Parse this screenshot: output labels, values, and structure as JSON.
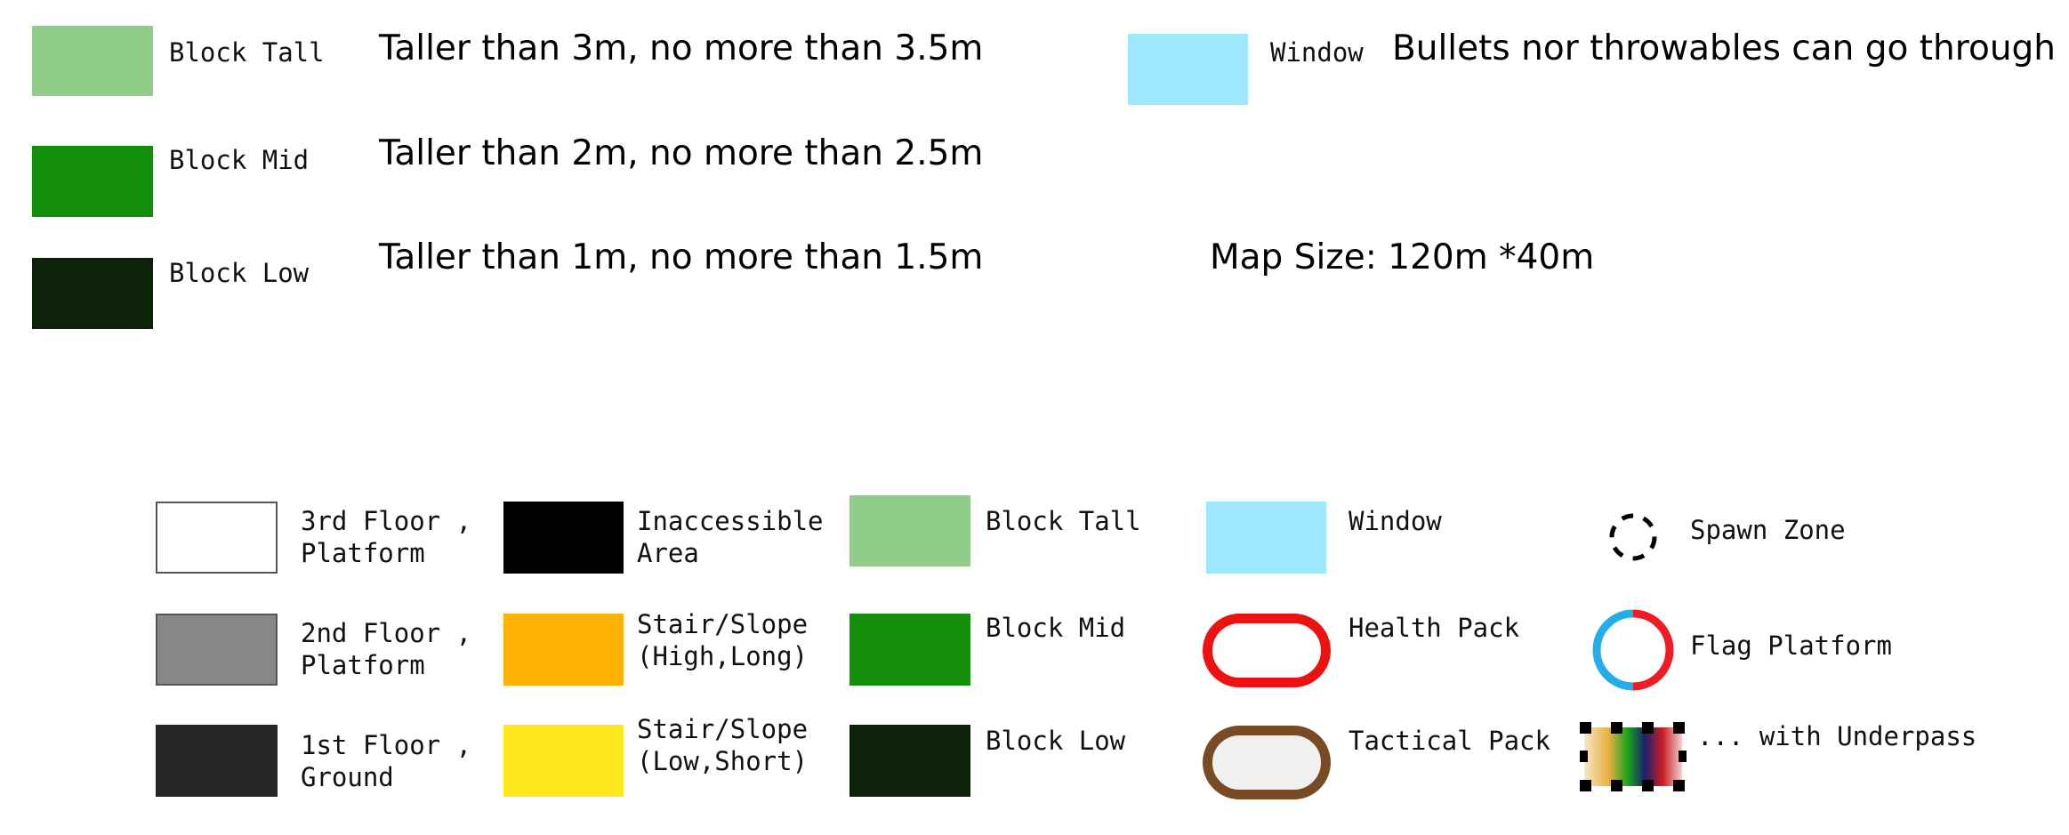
{
  "top_legend": {
    "block_tall": {
      "label": "Block Tall",
      "desc": "Taller than 3m, no more than 3.5m",
      "color": "#8fcd88"
    },
    "block_mid": {
      "label": "Block Mid",
      "desc": "Taller than 2m, no more than 2.5m",
      "color": "#148f0b"
    },
    "block_low": {
      "label": "Block Low",
      "desc": "Taller than 1m, no more than 1.5m",
      "color": "#0c2309"
    },
    "window": {
      "label": "Window",
      "desc": "Bullets nor throwables can go through",
      "color": "#9de8fd"
    },
    "map_size": "Map Size: 120m *40m"
  },
  "bottom_legend": {
    "floor3": {
      "label": "3rd Floor ,\nPlatform",
      "color": "#ffffff"
    },
    "floor2": {
      "label": "2nd Floor ,\nPlatform",
      "color": "#878787"
    },
    "floor1": {
      "label": "1st Floor ,\nGround",
      "color": "#262626"
    },
    "inaccessible": {
      "label": "Inaccessible\nArea",
      "color": "#000000"
    },
    "stair_high": {
      "label": "Stair/Slope\n(High,Long)",
      "color": "#feb304"
    },
    "stair_low": {
      "label": "Stair/Slope\n(Low,Short)",
      "color": "#ffe81c"
    },
    "block_tall": {
      "label": "Block Tall",
      "color": "#8fcd88"
    },
    "block_mid": {
      "label": "Block Mid",
      "color": "#148f0b"
    },
    "block_low": {
      "label": "Block Low",
      "color": "#0c2309"
    },
    "window": {
      "label": "Window",
      "color": "#9de8fd"
    },
    "health_pack": {
      "label": "Health Pack",
      "color": "#ee1111"
    },
    "tactical_pack": {
      "label": "Tactical Pack",
      "color": "#774c25"
    },
    "spawn_zone": {
      "label": "Spawn Zone"
    },
    "flag_platform": {
      "label": "Flag Platform",
      "color_a": "#24aee8",
      "color_b": "#ee1c25"
    },
    "underpass": {
      "label": "... with Underpass"
    }
  }
}
